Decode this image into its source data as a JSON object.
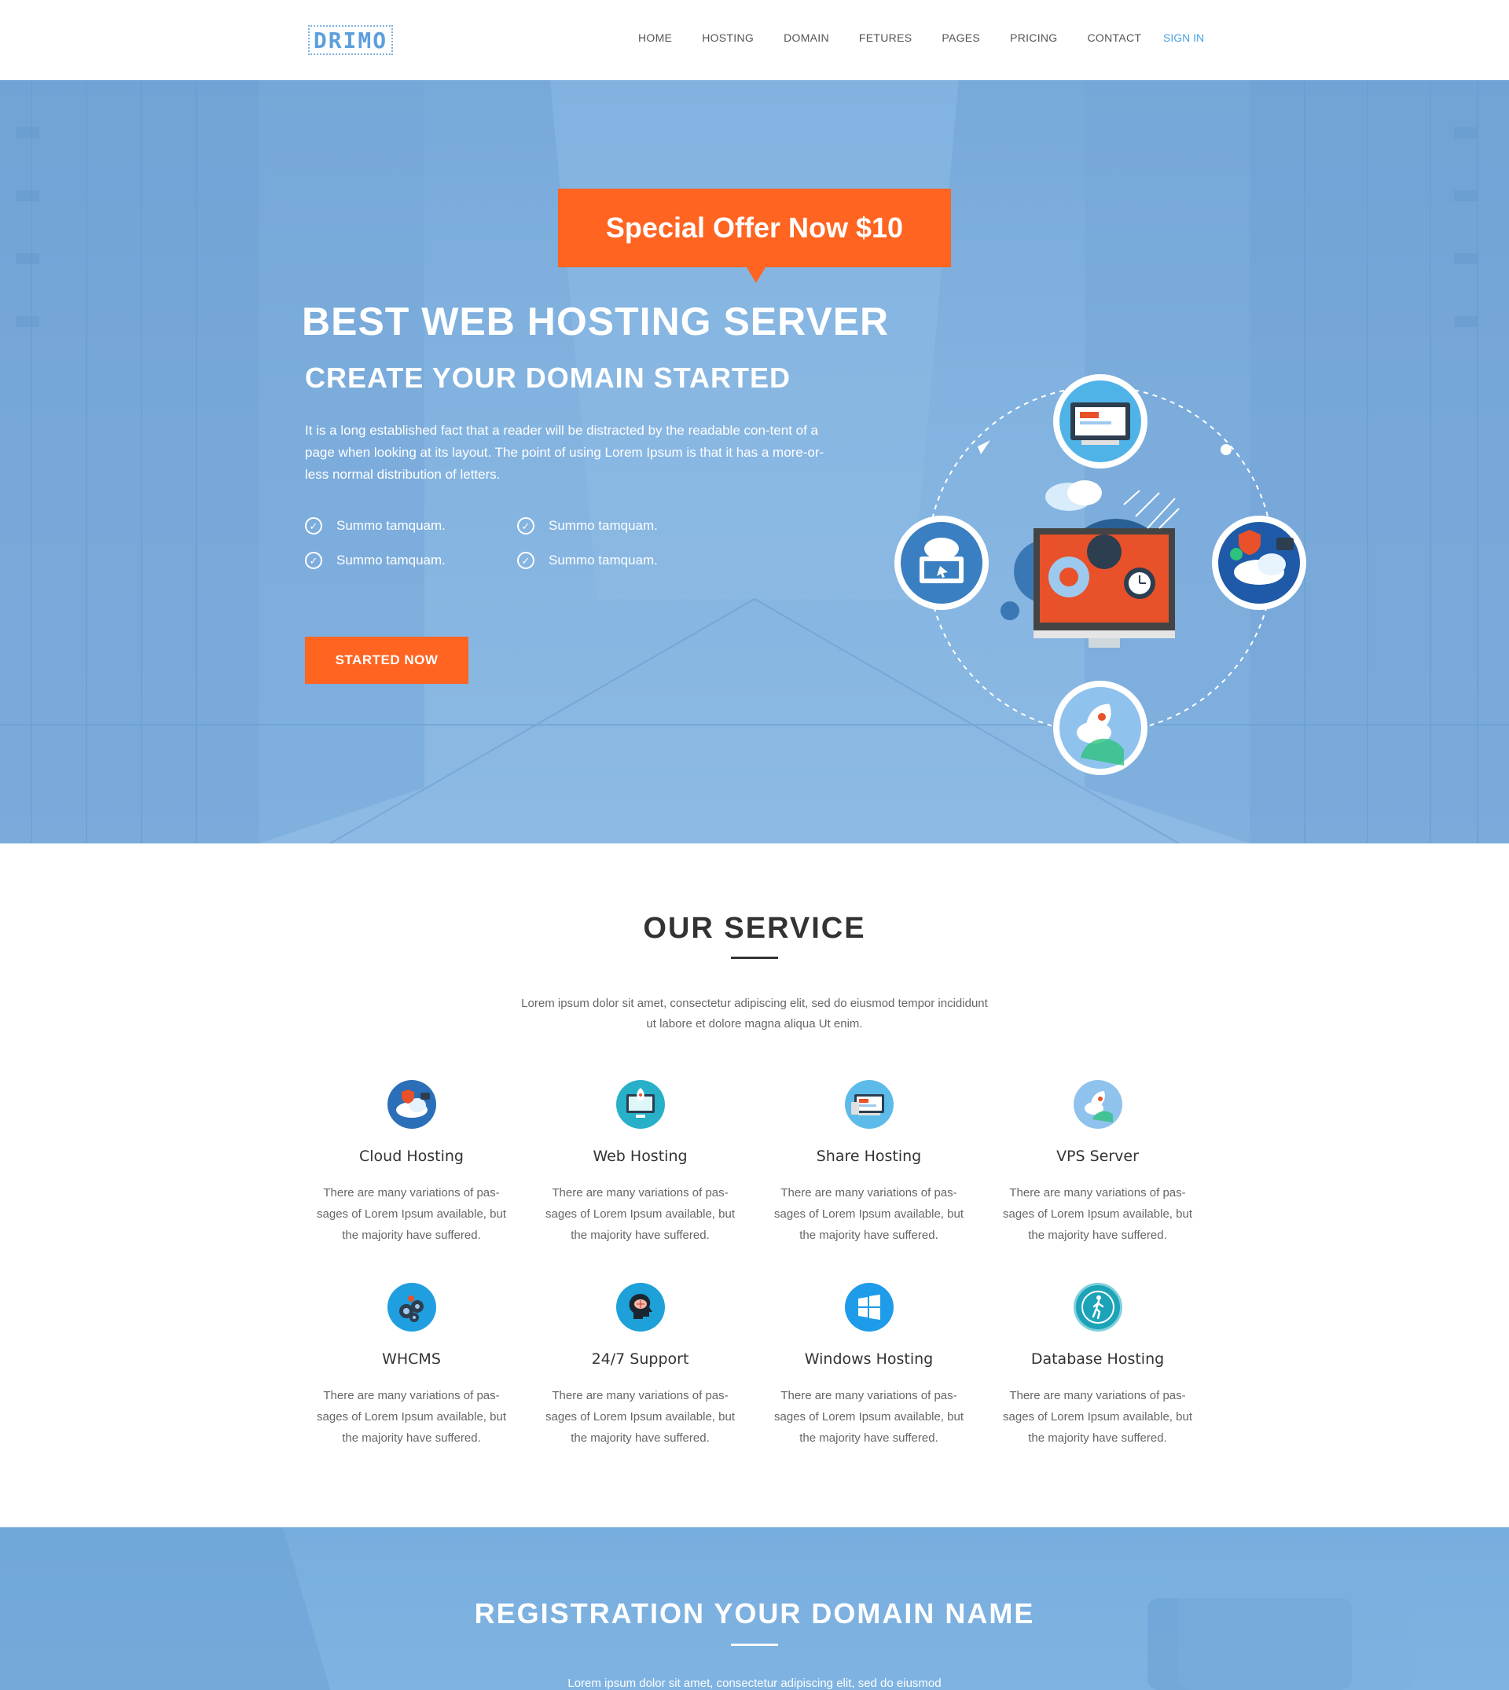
{
  "header": {
    "logo": "DRIMO",
    "nav": [
      "HOME",
      "HOSTING",
      "DOMAIN",
      "FETURES",
      "PAGES",
      "PRICING",
      "CONTACT"
    ],
    "signin": "SIGN IN"
  },
  "hero": {
    "offer": "Special Offer Now $10",
    "title": "BEST WEB HOSTING SERVER",
    "subtitle": "CREATE YOUR DOMAIN STARTED",
    "text": "It is a long established fact that a reader will be distracted by the readable con-tent of a page when looking at its layout. The point of using Lorem Ipsum is that it has a more-or-less normal distribution of letters.",
    "checks": [
      "Summo tamquam.",
      "Summo tamquam.",
      "Summo tamquam.",
      "Summo tamquam."
    ],
    "cta": "STARTED NOW"
  },
  "services": {
    "title": "OUR SERVICE",
    "description": "Lorem ipsum dolor sit amet, consectetur adipiscing elit, sed do eiusmod tempor incididunt ut labore et dolore magna aliqua Ut enim.",
    "items": [
      {
        "name": "Cloud Hosting",
        "text": "There are many variations of pas-sages of Lorem Ipsum available, but the majority have suffered.",
        "icon": "cloud-shield-icon"
      },
      {
        "name": "Web Hosting",
        "text": "There are many variations of pas-sages of Lorem Ipsum available, but the majority have suffered.",
        "icon": "rocket-monitor-icon"
      },
      {
        "name": "Share Hosting",
        "text": "There are many variations of pas-sages of Lorem Ipsum available, but the majority have suffered.",
        "icon": "devices-icon"
      },
      {
        "name": "VPS Server",
        "text": "There are many variations of pas-sages of Lorem Ipsum available, but the majority have suffered.",
        "icon": "rocket-icon"
      },
      {
        "name": "WHCMS",
        "text": "There are many variations of pas-sages of Lorem Ipsum available, but the majority have suffered.",
        "icon": "gears-icon"
      },
      {
        "name": "24/7 Support",
        "text": "There are many variations of pas-sages of Lorem Ipsum available, but the majority have suffered.",
        "icon": "brain-head-icon"
      },
      {
        "name": "Windows Hosting",
        "text": "There are many variations of pas-sages of Lorem Ipsum available, but the majority have suffered.",
        "icon": "windows-icon"
      },
      {
        "name": "Database Hosting",
        "text": "There are many variations of pas-sages of Lorem Ipsum available, but the majority have suffered.",
        "icon": "walking-person-icon"
      }
    ]
  },
  "band": {
    "title": "REGISTRATION YOUR DOMAIN NAME",
    "description": "Lorem ipsum dolor sit amet, consectetur adipiscing elit, sed do eiusmod"
  },
  "colors": {
    "accent": "#ff6421",
    "primary_blue": "#5d9fdc",
    "hero_blue": "#82b2df",
    "link_blue": "#4aa3df"
  }
}
